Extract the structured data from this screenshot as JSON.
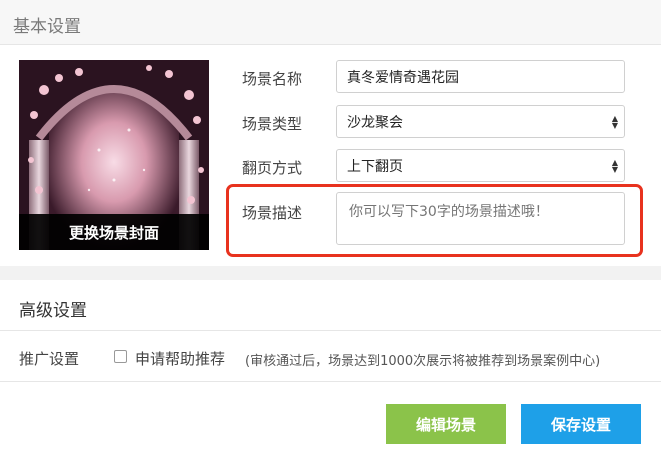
{
  "basic": {
    "header": "基本设置",
    "cover_button": "更换场景封面",
    "name_label": "场景名称",
    "name_value": "真冬爱情奇遇花园",
    "type_label": "场景类型",
    "type_value": "沙龙聚会",
    "flip_label": "翻页方式",
    "flip_value": "上下翻页",
    "desc_label": "场景描述",
    "desc_placeholder": "你可以写下30字的场景描述哦！"
  },
  "advanced": {
    "header": "高级设置",
    "promo_label": "推广设置",
    "checkbox_label": "申请帮助推荐",
    "note": "(审核通过后，场景达到1000次展示将被推荐到场景案例中心)"
  },
  "buttons": {
    "edit": "编辑场景",
    "save": "保存设置"
  },
  "colors": {
    "highlight": "#e8321e",
    "edit_button": "#8bc34a",
    "save_button": "#1ea0e8"
  }
}
